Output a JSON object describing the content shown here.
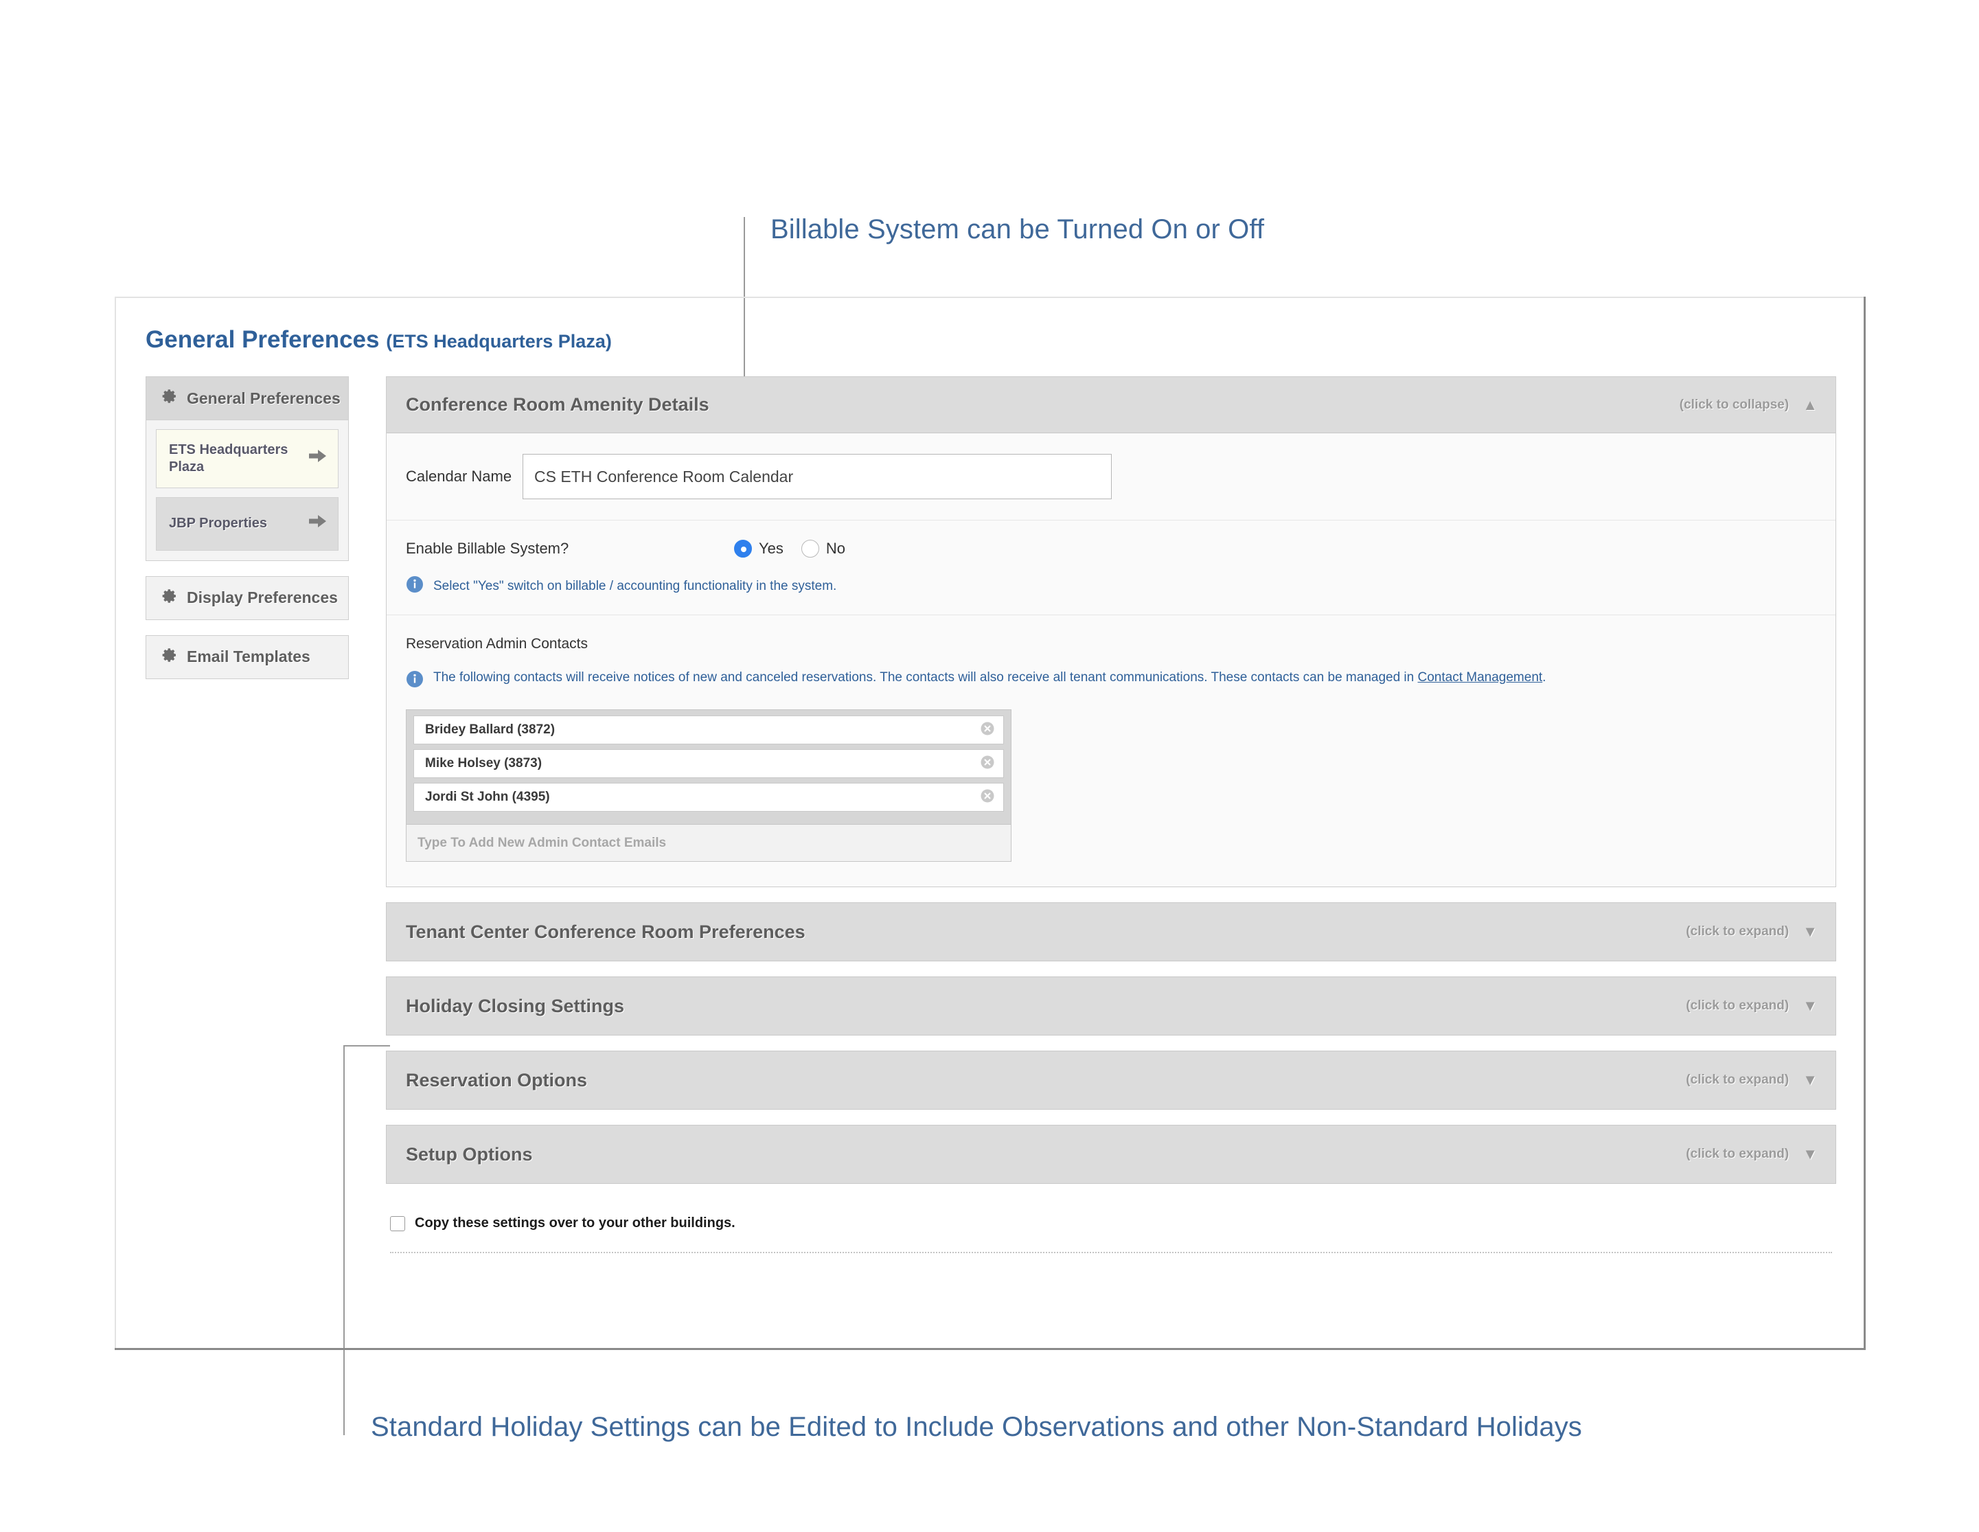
{
  "annotations": {
    "top": "Billable System can be Turned On or Off",
    "bottom": "Standard Holiday Settings can be Edited to Include Observations and other Non-Standard Holidays",
    "color": "#3f6899"
  },
  "page": {
    "title": "General Preferences",
    "subtitle": "(ETS Headquarters Plaza)",
    "title_color": "#2f6099"
  },
  "sidebar": {
    "groups": [
      {
        "label": "General Preferences",
        "icon": "gear-icon",
        "items": [
          {
            "label": "ETS Headquarters Plaza",
            "active": true,
            "icon": "arrow-right-icon"
          },
          {
            "label": "JBP Properties",
            "active": false,
            "icon": "arrow-right-icon"
          }
        ]
      },
      {
        "label": "Display Preferences",
        "icon": "gear-icon",
        "items": []
      },
      {
        "label": "Email Templates",
        "icon": "gear-icon",
        "items": []
      }
    ]
  },
  "main": {
    "expanded_section": {
      "title": "Conference Room Amenity Details",
      "toggle_label": "(click to collapse)",
      "caret": "▲",
      "calendar_name": {
        "label": "Calendar Name",
        "value": "CS ETH Conference Room Calendar",
        "placeholder": "Calendar Name"
      },
      "billable": {
        "label": "Enable Billable System?",
        "options": [
          {
            "label": "Yes",
            "selected": true
          },
          {
            "label": "No",
            "selected": false
          }
        ],
        "hint": "Select \"Yes\" switch on billable / accounting functionality in the system.",
        "hint_icon": "info-icon"
      },
      "contacts": {
        "title": "Reservation Admin Contacts",
        "note_icon": "info-icon",
        "note_text": "The following contacts will receive notices of new and canceled reservations. The contacts will also receive all tenant communications. These contacts can be managed in ",
        "note_link": "Contact Management",
        "note_tail": ".",
        "chips": [
          {
            "label": "Bridey Ballard (3872)",
            "remove_icon": "remove-circle-icon"
          },
          {
            "label": "Mike Holsey (3873)",
            "remove_icon": "remove-circle-icon"
          },
          {
            "label": "Jordi St John (4395)",
            "remove_icon": "remove-circle-icon"
          }
        ],
        "input_placeholder": "Type To Add New Admin Contact Emails"
      }
    },
    "collapsed_sections": [
      {
        "title": "Tenant Center Conference Room Preferences",
        "toggle_label": "(click to expand)",
        "caret": "▼"
      },
      {
        "title": "Holiday Closing Settings",
        "toggle_label": "(click to expand)",
        "caret": "▼"
      },
      {
        "title": "Reservation Options",
        "toggle_label": "(click to expand)",
        "caret": "▼"
      },
      {
        "title": "Setup Options",
        "toggle_label": "(click to expand)",
        "caret": "▼"
      }
    ],
    "footer": {
      "copy_label": "Copy these settings over to your other buildings.",
      "copy_checked": false
    }
  }
}
